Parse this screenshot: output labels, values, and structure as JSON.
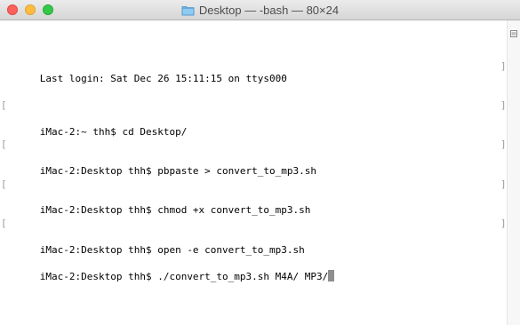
{
  "window": {
    "title": "Desktop — -bash — 80×24"
  },
  "icons": {
    "title": "folder-icon",
    "scroll": "scroll-marker-icon"
  },
  "colors": {
    "close": "#fc605b",
    "minimize": "#fdbc40",
    "zoom": "#34c84a",
    "cursor": "#8e8e8e"
  },
  "terminal": {
    "lines": [
      "Last login: Sat Dec 26 15:11:15 on ttys000",
      "iMac-2:~ thh$ cd Desktop/",
      "iMac-2:Desktop thh$ pbpaste > convert_to_mp3.sh",
      "iMac-2:Desktop thh$ chmod +x convert_to_mp3.sh",
      "iMac-2:Desktop thh$ open -e convert_to_mp3.sh",
      "iMac-2:Desktop thh$ ./convert_to_mp3.sh M4A/ MP3/"
    ]
  }
}
